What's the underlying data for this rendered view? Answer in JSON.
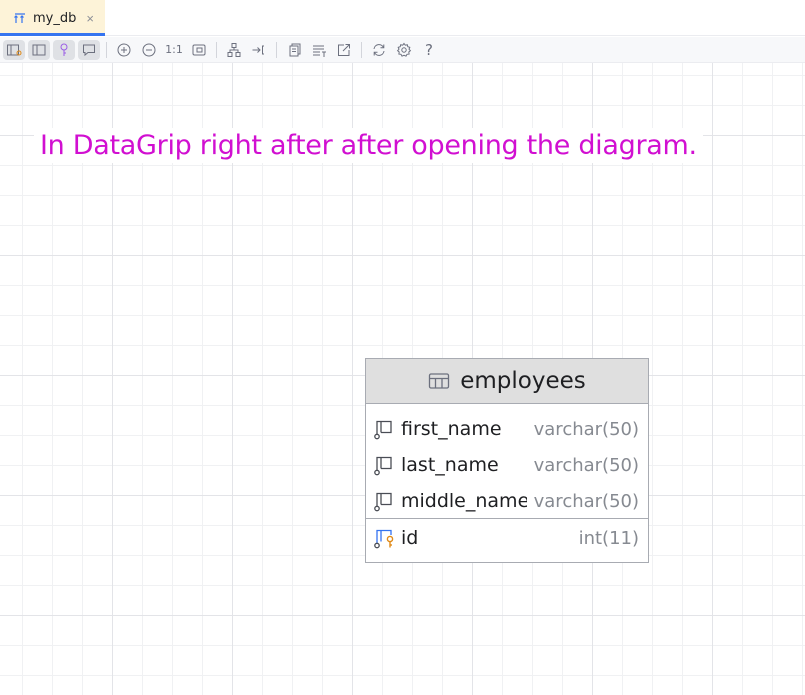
{
  "tab": {
    "label": "my_db",
    "close": "×"
  },
  "toolbar": {
    "actual_size_label": "1:1",
    "help_label": "?"
  },
  "note": "In DataGrip right after after opening the diagram.",
  "table": {
    "name": "employees",
    "columns": [
      {
        "name": "first_name",
        "type": "varchar(50)"
      },
      {
        "name": "last_name",
        "type": "varchar(50)"
      },
      {
        "name": "middle_name",
        "type": "varchar(50)"
      }
    ],
    "key_columns": [
      {
        "name": "id",
        "type": "int(11)"
      }
    ]
  },
  "colors": {
    "note": "#d10fd1",
    "tab_accent": "#3574f0",
    "key_icon": "#e08a17"
  }
}
